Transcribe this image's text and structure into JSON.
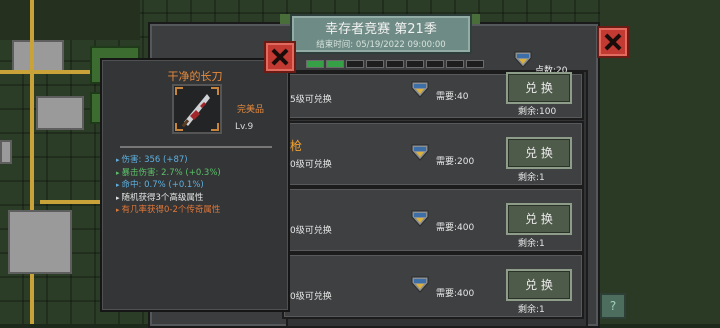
{
  "colors": {
    "accent_green": "#35a046",
    "close_red": "#c23a32",
    "item_orange": "#e68a3d",
    "stat_blue": "#5fb0e0",
    "stat_green": "#5cc06a",
    "stat_orange": "#e0773a"
  },
  "shop": {
    "title": "幸存者竞赛 第21季",
    "end_time": "结束时间: 05/19/2022 09:00:00",
    "points_label": "点数:20",
    "tabs": [
      {
        "active": true
      },
      {
        "active": true
      },
      {
        "active": false
      },
      {
        "active": false
      },
      {
        "active": false
      },
      {
        "active": false
      },
      {
        "active": false
      },
      {
        "active": false
      },
      {
        "active": false
      }
    ],
    "rows": [
      {
        "requirement": "5级可兑换",
        "name": "",
        "price": "需要:40",
        "button": "兑 换",
        "remaining": "剩余:100"
      },
      {
        "requirement": "0级可兑换",
        "name": "枪",
        "price": "需要:200",
        "button": "兑 换",
        "remaining": "剩余:1"
      },
      {
        "requirement": "0级可兑换",
        "name": "",
        "price": "需要:400",
        "button": "兑 换",
        "remaining": "剩余:1"
      },
      {
        "requirement": "0级可兑换",
        "name": "",
        "price": "需要:400",
        "button": "兑 换",
        "remaining": "剩余:1"
      }
    ],
    "help_label": "?"
  },
  "tooltip": {
    "item_name": "干净的长刀",
    "grade": "完美品",
    "level": "Lv.9",
    "icon": "machete-icon",
    "stats": [
      {
        "text": "伤害: 356 (+87)",
        "color": "blue"
      },
      {
        "text": "暴击伤害: 2.7% (+0.3%)",
        "color": "green"
      },
      {
        "text": "命中: 0.7% (+0.1%)",
        "color": "blue"
      },
      {
        "text": "随机获得3个高级属性",
        "color": "white"
      },
      {
        "text": "有几率获得0-2个传奇属性",
        "color": "orange"
      }
    ]
  }
}
